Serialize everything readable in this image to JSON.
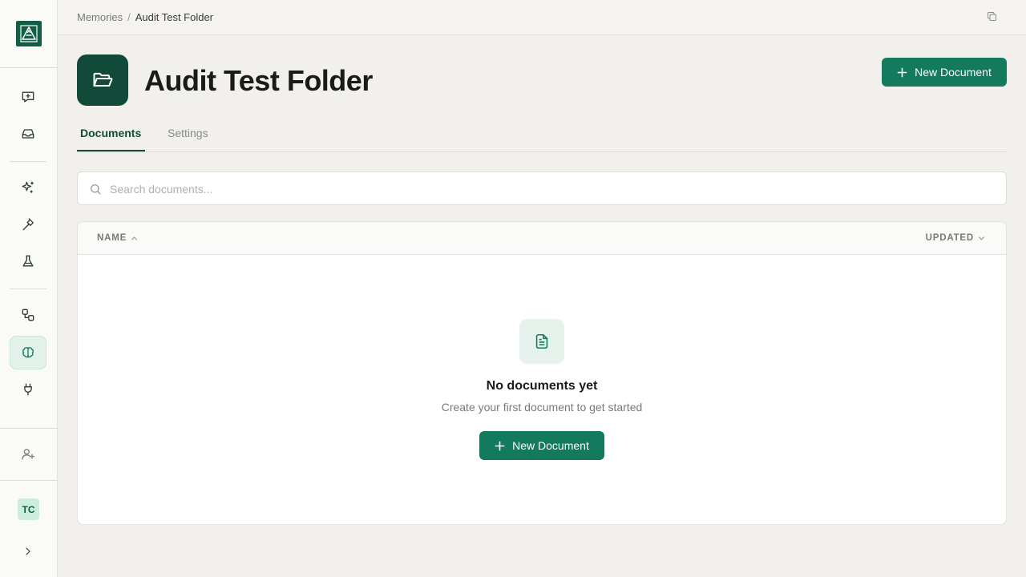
{
  "app": {
    "logo_icon": "mountain-logo-icon",
    "accent": "#137a5e",
    "brand_dark": "#124a39"
  },
  "sidebar": {
    "items": [
      {
        "name": "new-chat",
        "icon": "message-plus-icon"
      },
      {
        "name": "inbox",
        "icon": "inbox-icon"
      },
      {
        "name": "agents",
        "icon": "sparkles-icon"
      },
      {
        "name": "tools",
        "icon": "hammer-icon"
      },
      {
        "name": "evals",
        "icon": "flask-icon"
      },
      {
        "name": "workflows",
        "icon": "shapes-icon"
      },
      {
        "name": "memories",
        "icon": "brain-icon",
        "active": true
      },
      {
        "name": "integrations",
        "icon": "plug-icon"
      },
      {
        "name": "invite-user",
        "icon": "user-plus-icon"
      }
    ],
    "avatar_initials": "TC",
    "expand_icon": "chevron-right-icon"
  },
  "topbar": {
    "breadcrumb": {
      "parent": "Memories",
      "separator": "/",
      "current": "Audit Test Folder"
    },
    "copy_icon": "copy-icon"
  },
  "header": {
    "title": "Audit Test Folder",
    "folder_icon": "folder-open-icon",
    "new_button_label": "New Document"
  },
  "tabs": [
    {
      "label": "Documents",
      "active": true
    },
    {
      "label": "Settings",
      "active": false
    }
  ],
  "search": {
    "placeholder": "Search documents...",
    "value": ""
  },
  "table": {
    "columns": [
      {
        "label": "NAME",
        "sort": "asc"
      },
      {
        "label": "UPDATED",
        "sort": "desc"
      }
    ],
    "rows": [],
    "empty": {
      "icon": "file-text-icon",
      "title": "No documents yet",
      "subtitle": "Create your first document to get started",
      "button_label": "New Document"
    }
  }
}
